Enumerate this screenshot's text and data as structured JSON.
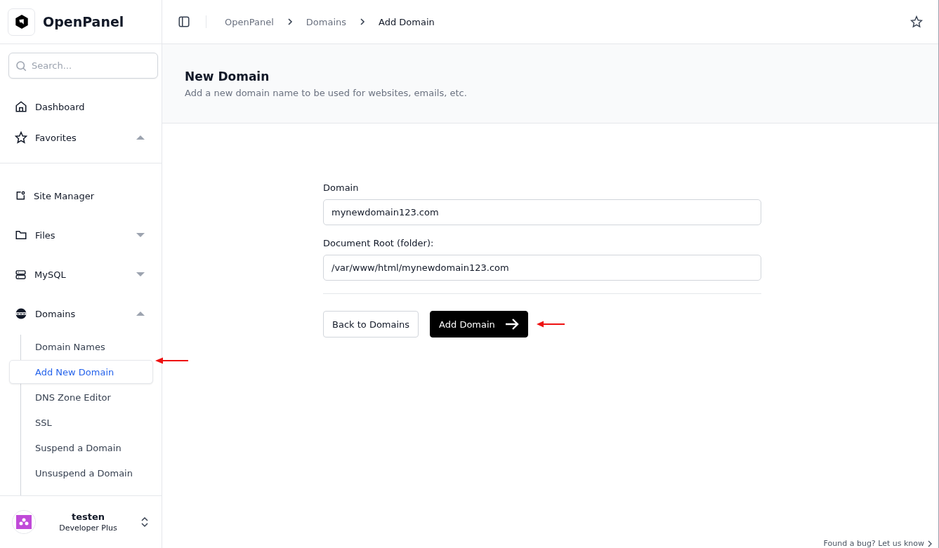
{
  "sidebar": {
    "brand": "OpenPanel",
    "search": {
      "placeholder": "Search..."
    },
    "top_items": [
      {
        "label": "Dashboard"
      },
      {
        "label": "Favorites",
        "expanded": true
      }
    ],
    "items": [
      {
        "label": "Site Manager"
      },
      {
        "label": "Files",
        "expanded": false
      },
      {
        "label": "MySQL",
        "expanded": false
      },
      {
        "label": "Domains",
        "expanded": true,
        "children": [
          {
            "label": "Domain Names",
            "selected": false
          },
          {
            "label": "Add New Domain",
            "selected": true
          },
          {
            "label": "DNS Zone Editor",
            "selected": false
          },
          {
            "label": "SSL",
            "selected": false
          },
          {
            "label": "Suspend a Domain",
            "selected": false
          },
          {
            "label": "Unsuspend a Domain",
            "selected": false
          }
        ]
      }
    ],
    "user": {
      "name": "testen",
      "plan": "Developer Plus"
    }
  },
  "breadcrumb": [
    {
      "label": "OpenPanel",
      "current": false
    },
    {
      "label": "Domains",
      "current": false
    },
    {
      "label": "Add Domain",
      "current": true
    }
  ],
  "header": {
    "title": "New Domain",
    "subtitle": "Add a new domain name to be used for websites, emails, etc."
  },
  "form": {
    "fields": [
      {
        "label": "Domain",
        "value": "mynewdomain123.com"
      },
      {
        "label": "Document Root (folder):",
        "value": "/var/www/html/mynewdomain123.com"
      }
    ],
    "back_button": "Back to Domains",
    "submit_button": "Add Domain"
  },
  "footer_link": "Found a bug? Let us know"
}
